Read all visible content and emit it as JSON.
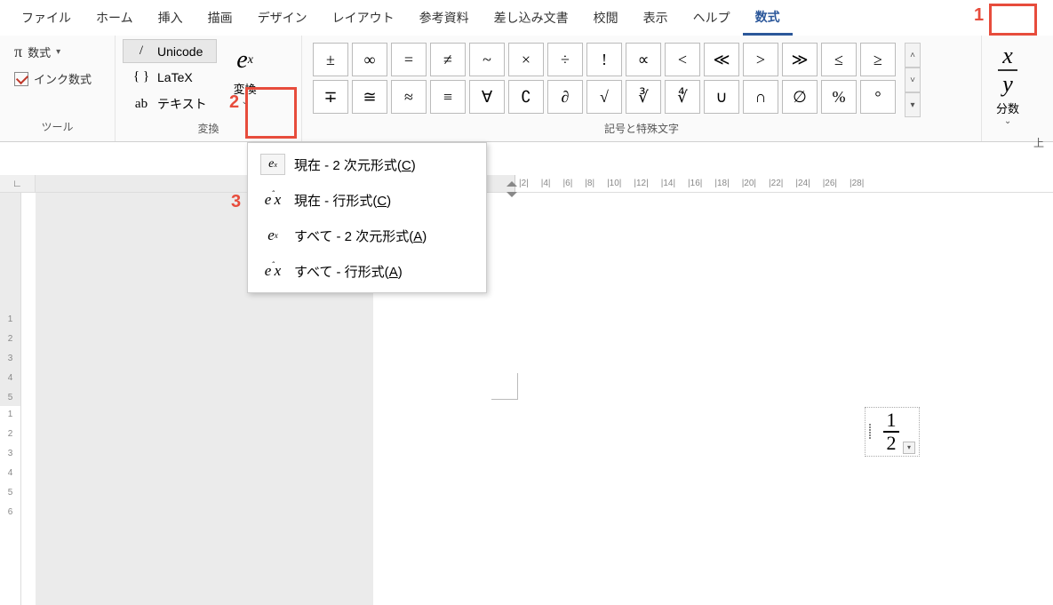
{
  "tabs": [
    "ファイル",
    "ホーム",
    "挿入",
    "描画",
    "デザイン",
    "レイアウト",
    "参考資料",
    "差し込み文書",
    "校閲",
    "表示",
    "ヘルプ",
    "数式"
  ],
  "active_tab": "数式",
  "groups": {
    "tool": {
      "label": "ツール",
      "equation_btn": "数式",
      "ink_btn": "インク数式"
    },
    "convert": {
      "label": "変換",
      "unicode": "Unicode",
      "latex": "LaTeX",
      "text": "テキスト",
      "convert_btn": "変換"
    },
    "symbols": {
      "label": "記号と特殊文字",
      "row1": [
        "±",
        "∞",
        "=",
        "≠",
        "~",
        "×",
        "÷",
        "!",
        "∝",
        "<",
        "≪",
        ">",
        "≫",
        "≤",
        "≥"
      ],
      "row2": [
        "∓",
        "≅",
        "≈",
        "≡",
        "∀",
        "∁",
        "∂",
        "√",
        "∛",
        "∜",
        "∪",
        "∩",
        "∅",
        "%",
        "°"
      ]
    },
    "structures": {
      "fraction_label": "分数",
      "more_label": "上"
    }
  },
  "dropdown": {
    "items": [
      {
        "icon": "e^x",
        "icon_boxed": true,
        "text_pre": "現在 - 2 次元形式(",
        "accel": "C",
        "text_post": ")"
      },
      {
        "icon": "e^x",
        "icon_boxed": false,
        "text_pre": "現在 - 行形式(",
        "accel": "C",
        "text_post": ")",
        "highlighted": true
      },
      {
        "icon": "e^x",
        "icon_boxed": false,
        "sup": true,
        "text_pre": "すべて - 2 次元形式(",
        "accel": "A",
        "text_post": ")"
      },
      {
        "icon": "e^x",
        "icon_boxed": false,
        "text_pre": "すべて - 行形式(",
        "accel": "A",
        "text_post": ")"
      }
    ]
  },
  "ruler_h": [
    "|2|",
    "|4|",
    "|6|",
    "|8|",
    "|10|",
    "|12|",
    "|14|",
    "|16|",
    "|18|",
    "|20|",
    "|22|",
    "|24|",
    "|26|",
    "|28|"
  ],
  "ruler_v_gray": [
    "5",
    "4",
    "3",
    "2",
    "1"
  ],
  "ruler_v_white": [
    "1",
    "2",
    "3",
    "4",
    "5",
    "6"
  ],
  "equation": {
    "num": "1",
    "den": "2"
  },
  "callouts": {
    "1": "1",
    "2": "2",
    "3": "3"
  }
}
